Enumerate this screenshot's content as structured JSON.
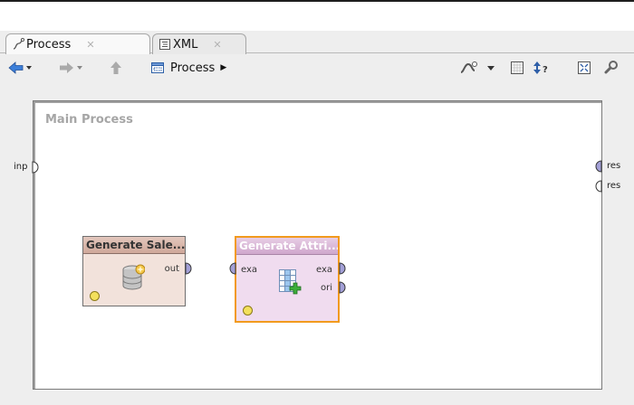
{
  "tabs": [
    {
      "label": "Process",
      "close": "✕"
    },
    {
      "label": "XML",
      "close": "✕"
    }
  ],
  "toolbar": {
    "breadcrumb": "Process",
    "breadcrumb_arrow": "▶",
    "icons": [
      "back-arrow-icon",
      "dropdown-icon",
      "forward-arrow-icon",
      "dropdown-icon",
      "up-arrow-icon",
      "process-icon",
      "auto-wire-icon",
      "dropdown-icon",
      "grid-icon",
      "ordering-icon",
      "fit-icon",
      "link-icon"
    ]
  },
  "canvas": {
    "title": "Main Process",
    "input_port": "inp",
    "result_ports": [
      "res",
      "res"
    ]
  },
  "operators": [
    {
      "name": "Generate Sale...",
      "out_ports": [
        "out"
      ],
      "in_ports": [],
      "icon": "database-icon",
      "status": "yellow"
    },
    {
      "name": "Generate Attri...",
      "in_ports": [
        "exa"
      ],
      "out_ports": [
        "exa",
        "ori"
      ],
      "icon": "table-add-icon",
      "status": "yellow",
      "selected": true
    }
  ],
  "colors": {
    "port_connected": "#a3a0d7",
    "wire": "#a9a3e0",
    "selection": "#f29a1e",
    "status": "#f3e05c"
  }
}
